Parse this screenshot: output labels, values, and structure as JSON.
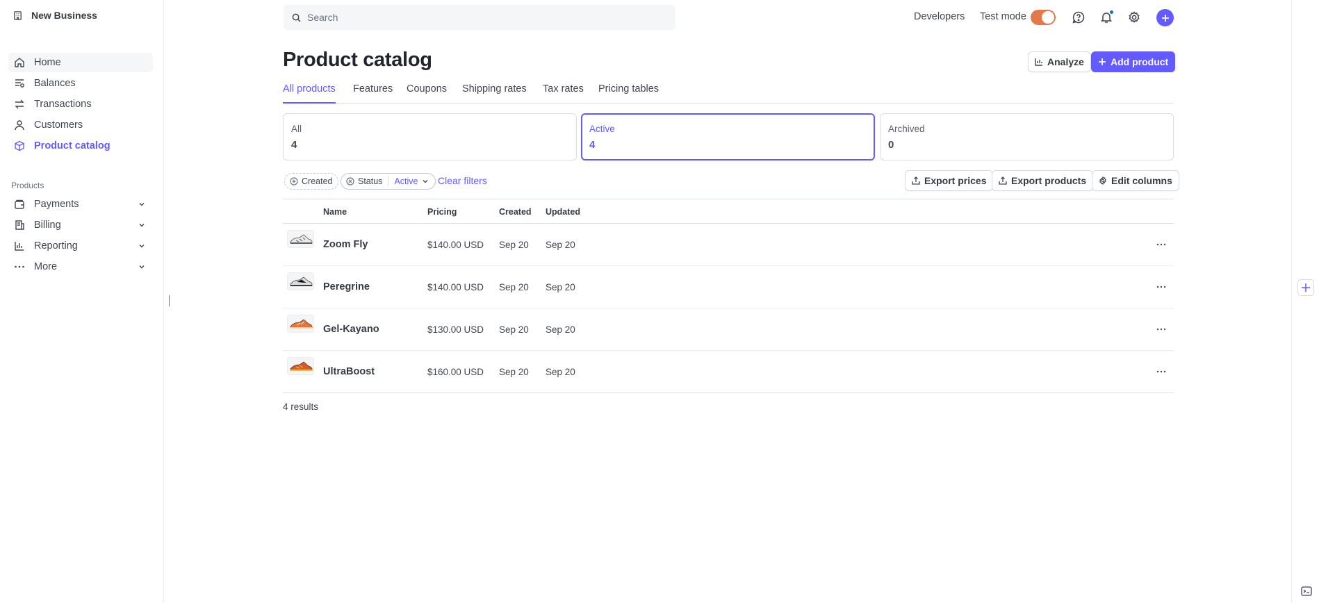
{
  "sidebar": {
    "business_name": "New Business",
    "items": [
      {
        "label": "Home",
        "icon": "home-icon"
      },
      {
        "label": "Balances",
        "icon": "balances-icon"
      },
      {
        "label": "Transactions",
        "icon": "transactions-icon"
      },
      {
        "label": "Customers",
        "icon": "person-icon"
      },
      {
        "label": "Product catalog",
        "icon": "box-icon"
      }
    ],
    "section_label": "Products",
    "product_items": [
      {
        "label": "Payments",
        "icon": "wallet-icon"
      },
      {
        "label": "Billing",
        "icon": "billing-icon"
      },
      {
        "label": "Reporting",
        "icon": "bar-chart-icon"
      },
      {
        "label": "More",
        "icon": "ellipsis-icon"
      }
    ]
  },
  "topbar": {
    "search_placeholder": "Search",
    "developers_label": "Developers",
    "test_mode_label": "Test mode",
    "test_mode_on": true,
    "icons": [
      "help-icon",
      "bell-icon",
      "settings-icon",
      "plus-icon"
    ]
  },
  "header": {
    "title": "Product catalog",
    "analyze_label": "Analyze",
    "add_product_label": "Add product"
  },
  "tabs": [
    {
      "label": "All products",
      "active": true
    },
    {
      "label": "Features",
      "active": false
    },
    {
      "label": "Coupons",
      "active": false
    },
    {
      "label": "Shipping rates",
      "active": false
    },
    {
      "label": "Tax rates",
      "active": false
    },
    {
      "label": "Pricing tables",
      "active": false
    }
  ],
  "filter_cards": [
    {
      "label": "All",
      "count": "4",
      "selected": false
    },
    {
      "label": "Active",
      "count": "4",
      "selected": true
    },
    {
      "label": "Archived",
      "count": "0",
      "selected": false
    }
  ],
  "filters": {
    "created_label": "Created",
    "status_label": "Status",
    "status_value": "Active",
    "clear_label": "Clear filters"
  },
  "actions": {
    "export_prices": "Export prices",
    "export_products": "Export products",
    "edit_columns": "Edit columns"
  },
  "table": {
    "columns": [
      "Name",
      "Pricing",
      "Created",
      "Updated"
    ],
    "rows": [
      {
        "name": "Zoom Fly",
        "pricing": "$140.00 USD",
        "created": "Sep 20",
        "updated": "Sep 20",
        "shoe_color": "#d9d9d9"
      },
      {
        "name": "Peregrine",
        "pricing": "$140.00 USD",
        "created": "Sep 20",
        "updated": "Sep 20",
        "shoe_color": "#cfcfcf"
      },
      {
        "name": "Gel-Kayano",
        "pricing": "$130.00 USD",
        "created": "Sep 20",
        "updated": "Sep 20",
        "shoe_color": "#e0763a"
      },
      {
        "name": "UltraBoost",
        "pricing": "$160.00 USD",
        "created": "Sep 20",
        "updated": "Sep 20",
        "shoe_color": "#d95a2a"
      }
    ],
    "results_label": "4 results"
  },
  "colors": {
    "accent": "#635bff",
    "toggle": "#e3794a"
  }
}
